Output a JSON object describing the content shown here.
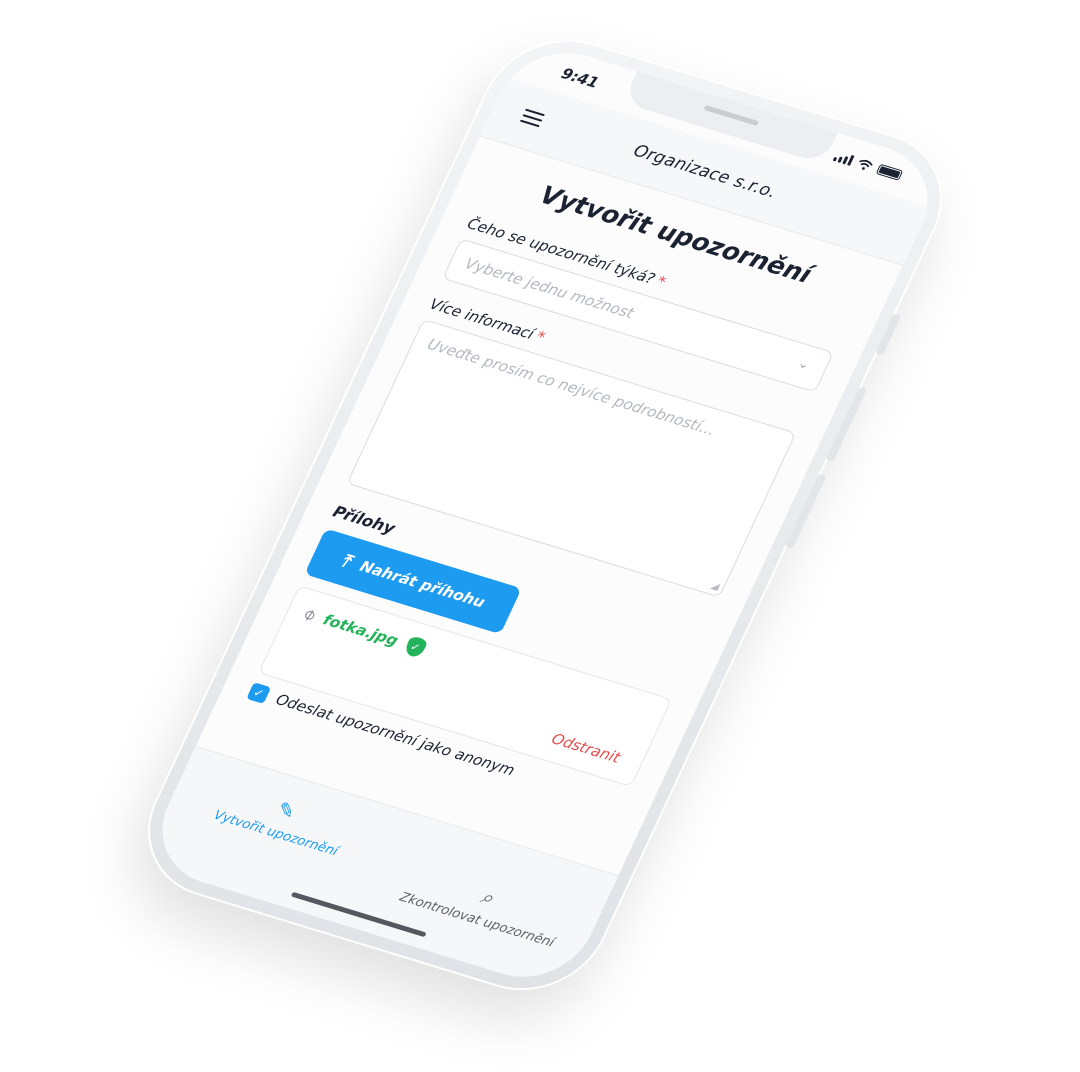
{
  "status": {
    "time": "9:41"
  },
  "header": {
    "org_name": "Organizace s.r.o."
  },
  "form": {
    "title": "Vytvořit upozornění",
    "topic_label": "Čeho se upozornění týká?",
    "topic_placeholder": "Vyberte jednu možnost",
    "details_label": "Více informací",
    "details_placeholder": "Uveďte prosím co nejvíce podrobností...",
    "required_mark": "*",
    "attachments_label": "Přílohy",
    "upload_button": "Nahrát příhohu",
    "attachment": {
      "file_name": "fotka.jpg",
      "remove_label": "Odstranit"
    },
    "anonymous_label": "Odeslat upozornění jako anonym"
  },
  "nav": {
    "tabs": [
      {
        "label": "Vytvořit upozornění",
        "active": true
      },
      {
        "label": "Zkontrolovat upozornění",
        "active": false
      }
    ]
  },
  "colors": {
    "accent": "#1d9bf0",
    "success": "#23b35a",
    "danger": "#e54b4b",
    "text": "#1b2333"
  }
}
